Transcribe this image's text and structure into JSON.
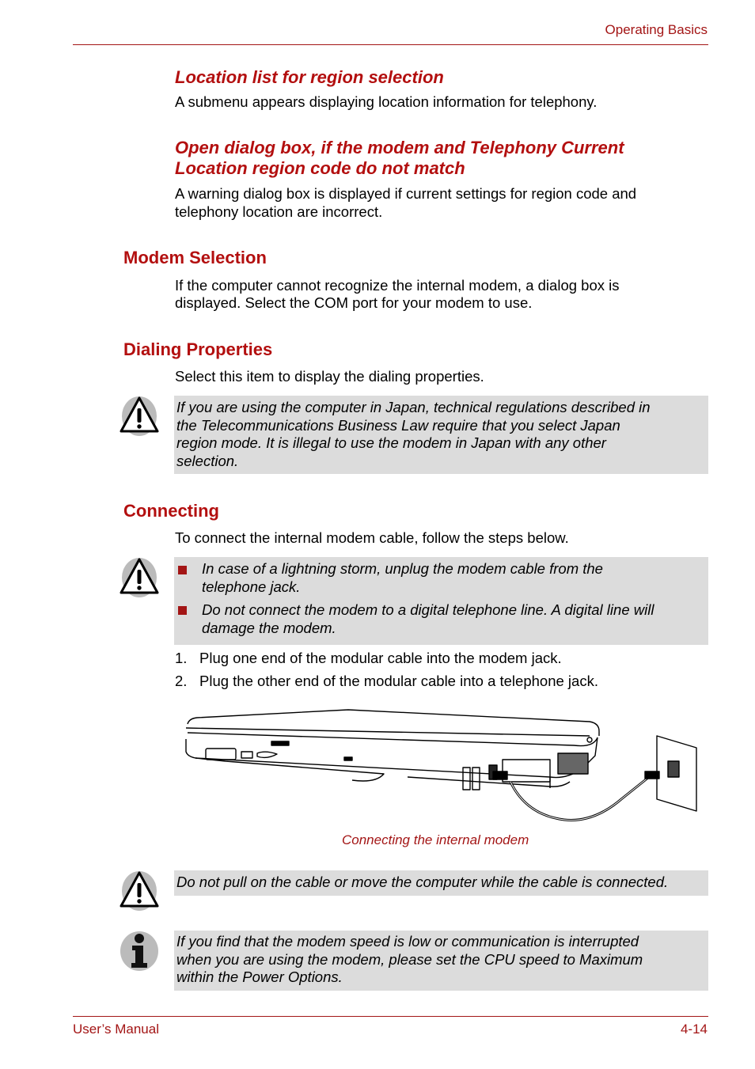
{
  "header": {
    "section_title": "Operating Basics"
  },
  "sections": {
    "location_list": {
      "title": "Location list for region selection",
      "text": "A submenu appears displaying location information for telephony."
    },
    "open_dialog": {
      "title_line1": "Open dialog box, if the modem and Telephony Current",
      "title_line2": "Location region code do not match",
      "text_line1": "A warning dialog box is displayed if current settings for region code and",
      "text_line2": "telephony location are incorrect."
    },
    "modem_selection": {
      "title": "Modem Selection",
      "text_line1": "If the computer cannot recognize the internal modem, a dialog box is",
      "text_line2": "displayed. Select the COM port for your modem to use."
    },
    "dialing_properties": {
      "title": "Dialing Properties",
      "text": "Select this item to display the dialing properties.",
      "caution": {
        "icon": "warning-icon",
        "lines": [
          "If you are using the computer in Japan, technical regulations described in",
          "the Telecommunications Business Law require that you select Japan",
          "region mode. It is illegal to use the modem in Japan with any other",
          "selection."
        ]
      }
    },
    "connecting": {
      "title": "Connecting",
      "text": "To connect the internal modem cable, follow the steps below.",
      "caution": {
        "icon": "warning-icon",
        "bullets": [
          {
            "line1": "In case of a lightning storm, unplug the modem cable from the",
            "line2": "telephone jack."
          },
          {
            "line1": "Do not connect the modem to a digital telephone line. A digital line will",
            "line2": "damage the modem."
          }
        ]
      },
      "steps": [
        {
          "num": "1.",
          "text": "Plug one end of the modular cable into the modem jack."
        },
        {
          "num": "2.",
          "text": "Plug the other end of the modular cable into a telephone jack."
        }
      ],
      "figure_caption": "Connecting the internal modem",
      "caution2": {
        "icon": "warning-icon",
        "text": "Do not pull on the cable or move the computer while the cable is connected."
      },
      "info_note": {
        "icon": "info-icon",
        "lines": [
          "If you find that the modem speed is low or communication is interrupted",
          "when you are using the modem, please set the CPU speed to Maximum",
          "within the Power Options."
        ]
      }
    }
  },
  "footer": {
    "manual_label": "User’s Manual",
    "page_number": "4-14"
  },
  "colors": {
    "accent": "#a31515",
    "note_bg": "#dcdcdc"
  }
}
